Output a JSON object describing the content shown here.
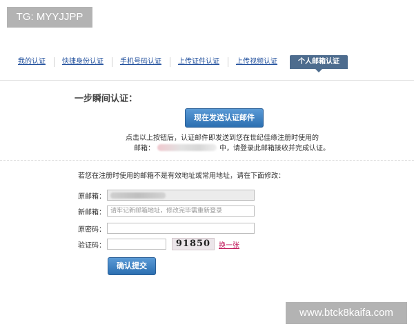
{
  "watermarks": {
    "top_left": "TG: MYYJJPP",
    "bottom_right": "www.btck8kaifa.com"
  },
  "tabs": [
    {
      "label": "我的认证",
      "active": false
    },
    {
      "label": "快捷身份认证",
      "active": false
    },
    {
      "label": "手机号码认证",
      "active": false
    },
    {
      "label": "上传证件认证",
      "active": false
    },
    {
      "label": "上传视频认证",
      "active": false
    },
    {
      "label": "个人邮箱认证",
      "active": true
    }
  ],
  "step": {
    "title": "一步瞬间认证：",
    "send_button": "现在发送认证邮件",
    "notice_line1": "点击以上按钮后，认证邮件即发送到您在世纪佳缘注册时使用的",
    "notice_line2_prefix": "邮箱：",
    "notice_line2_suffix": "中，请登录此邮箱接收并完成认证。"
  },
  "form": {
    "hint": "若您在注册时使用的邮箱不是有效地址或常用地址，请在下面修改：",
    "original_email_label": "原邮箱：",
    "new_email_label": "新邮箱：",
    "new_email_placeholder": "请牢记新邮箱地址，修改完毕需重新登录",
    "password_label": "原密码：",
    "captcha_label": "验证码：",
    "captcha_value": "91850",
    "change_captcha": "换一张",
    "submit_button": "确认提交"
  },
  "colors": {
    "link": "#1f4e9c",
    "active_tab": "#4d6c8e",
    "button": "#2c6fb1",
    "change_captcha": "#c2185b"
  }
}
